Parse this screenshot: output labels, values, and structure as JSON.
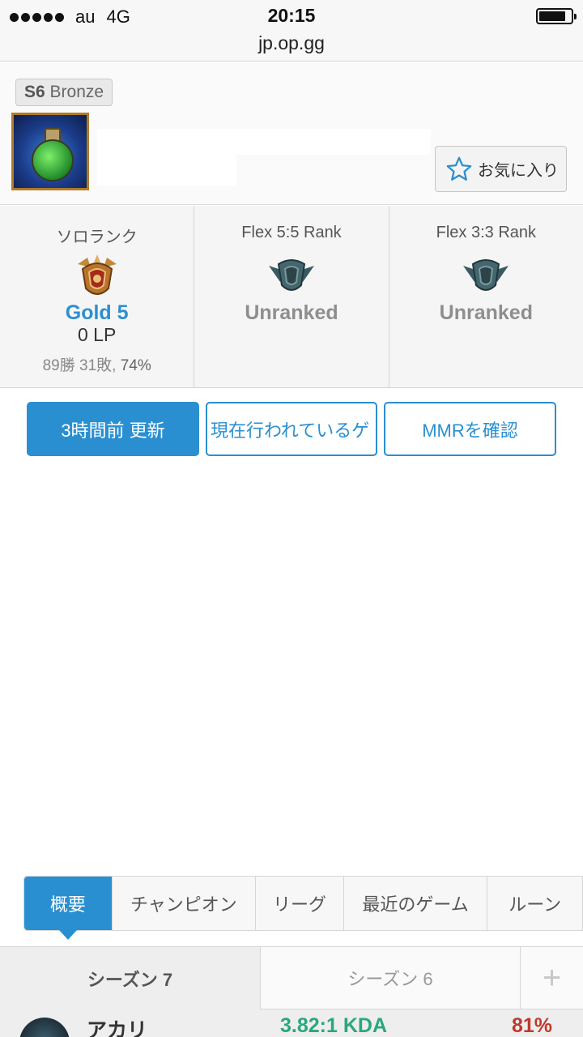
{
  "status_bar": {
    "carrier": "au",
    "network": "4G",
    "time": "20:15",
    "url": "jp.op.gg"
  },
  "profile": {
    "season_prefix": "S6",
    "season_tier": "Bronze",
    "favorite_label": "お気に入り",
    "avatar_icon": "potion-icon"
  },
  "ranks": [
    {
      "title": "ソロランク",
      "tier": "Gold 5",
      "lp": "0 LP",
      "record": "89勝 31敗,",
      "winrate": "74%"
    },
    {
      "title": "Flex 5:5 Rank",
      "tier": "Unranked"
    },
    {
      "title": "Flex 3:3 Rank",
      "tier": "Unranked"
    }
  ],
  "actions": {
    "update": "3時間前 更新",
    "live_game": "現在行われているゲ",
    "mmr": "MMRを確認"
  },
  "tabs": [
    "概要",
    "チャンピオン",
    "リーグ",
    "最近のゲーム",
    "ルーン"
  ],
  "seasons": {
    "active": "シーズン 7",
    "other": "シーズン 6",
    "add": "+"
  },
  "champion_stats": [
    {
      "name": "アカリ",
      "kda": "3.82:1 KDA",
      "winrate": "81%"
    }
  ],
  "colors": {
    "accent": "#2a8fd0",
    "kda_green": "#2aa87a",
    "winrate_red": "#c0392b"
  }
}
